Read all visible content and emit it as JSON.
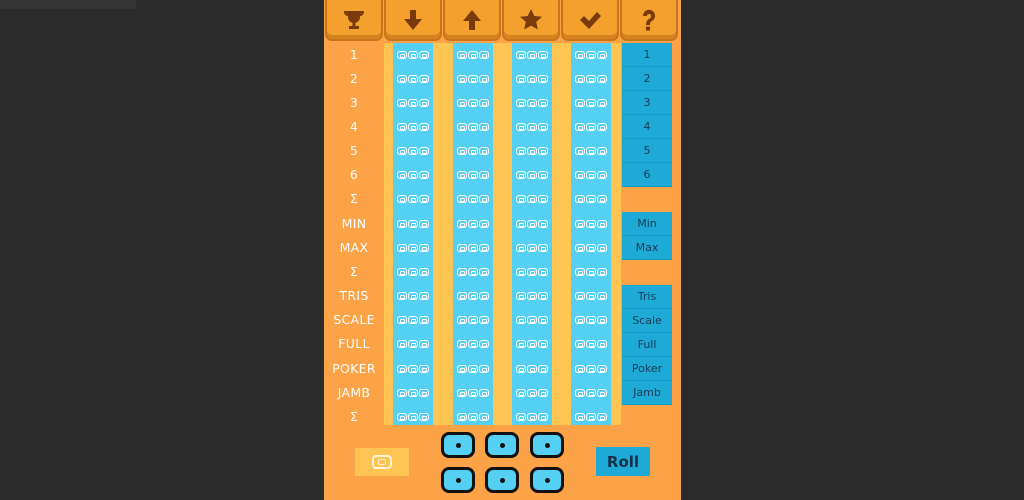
{
  "toolbar": {
    "buttons": [
      {
        "name": "trophy-icon"
      },
      {
        "name": "arrow-down-icon"
      },
      {
        "name": "arrow-up-icon"
      },
      {
        "name": "star-icon"
      },
      {
        "name": "checkmark-icon"
      },
      {
        "name": "question-mark-icon"
      }
    ]
  },
  "rows": [
    "1",
    "2",
    "3",
    "4",
    "5",
    "6",
    "Σ",
    "MIN",
    "MAX",
    "Σ",
    "TRIS",
    "SCALE",
    "FULL",
    "POKER",
    "JAMB",
    "Σ"
  ],
  "reference": {
    "numbers": [
      "1",
      "2",
      "3",
      "4",
      "5",
      "6"
    ],
    "minmax": [
      "Min",
      "Max"
    ],
    "combos": [
      "Tris",
      "Scale",
      "Full",
      "Poker",
      "Jamb"
    ]
  },
  "bottom": {
    "roll_label": "Roll",
    "dice_count": 6
  },
  "colors": {
    "background": "#2b2b2b",
    "panel": "#fca247",
    "column_stripe": "#ffc553",
    "score_cell": "#55d0f2",
    "reference_cell": "#1eaad6"
  }
}
